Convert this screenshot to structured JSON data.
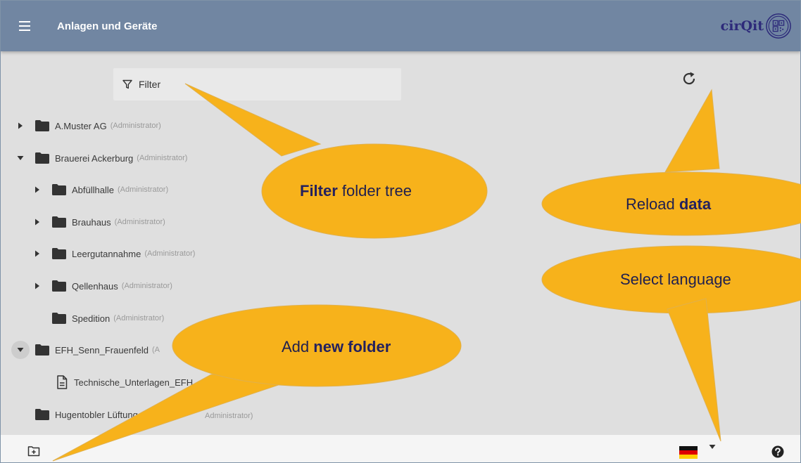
{
  "header": {
    "title": "Anlagen und Geräte",
    "brand": "cirQit"
  },
  "filter": {
    "placeholder": "Filter"
  },
  "tree": {
    "nodes": [
      {
        "label": "A.Muster AG",
        "role": "(Administrator)",
        "expanded": false
      },
      {
        "label": "Brauerei Ackerburg",
        "role": "(Administrator)",
        "expanded": true
      },
      {
        "label": "Abfüllhalle",
        "role": "(Administrator)",
        "expanded": false
      },
      {
        "label": "Brauhaus",
        "role": "(Administrator)",
        "expanded": false
      },
      {
        "label": "Leergutannahme",
        "role": "(Administrator)",
        "expanded": false
      },
      {
        "label": "Qellenhaus",
        "role": "(Administrator)",
        "expanded": false
      },
      {
        "label": "Spedition",
        "role": "(Administrator)"
      },
      {
        "label": "EFH_Senn_Frauenfeld",
        "role": "(A",
        "expanded": true
      },
      {
        "label": "Technische_Unterlagen_EFH",
        "type": "document"
      },
      {
        "label": "Hugentobler Lüftung",
        "role": "(Administrator)"
      }
    ]
  },
  "hidden_role_fragment": "Administrator)",
  "bottom": {
    "language": "de"
  },
  "callouts": {
    "filter": {
      "bold": "Filter",
      "rest": " folder tree"
    },
    "reload": {
      "text": "Reload ",
      "bold": "data"
    },
    "language": {
      "text": "Select language"
    },
    "add_folder": {
      "text": "Add ",
      "bold": "new folder"
    }
  },
  "colors": {
    "appbar": "#7186a2",
    "content_bg": "#dfdfdf",
    "callout": "#f7b21b",
    "brand": "#2d2a7a"
  }
}
